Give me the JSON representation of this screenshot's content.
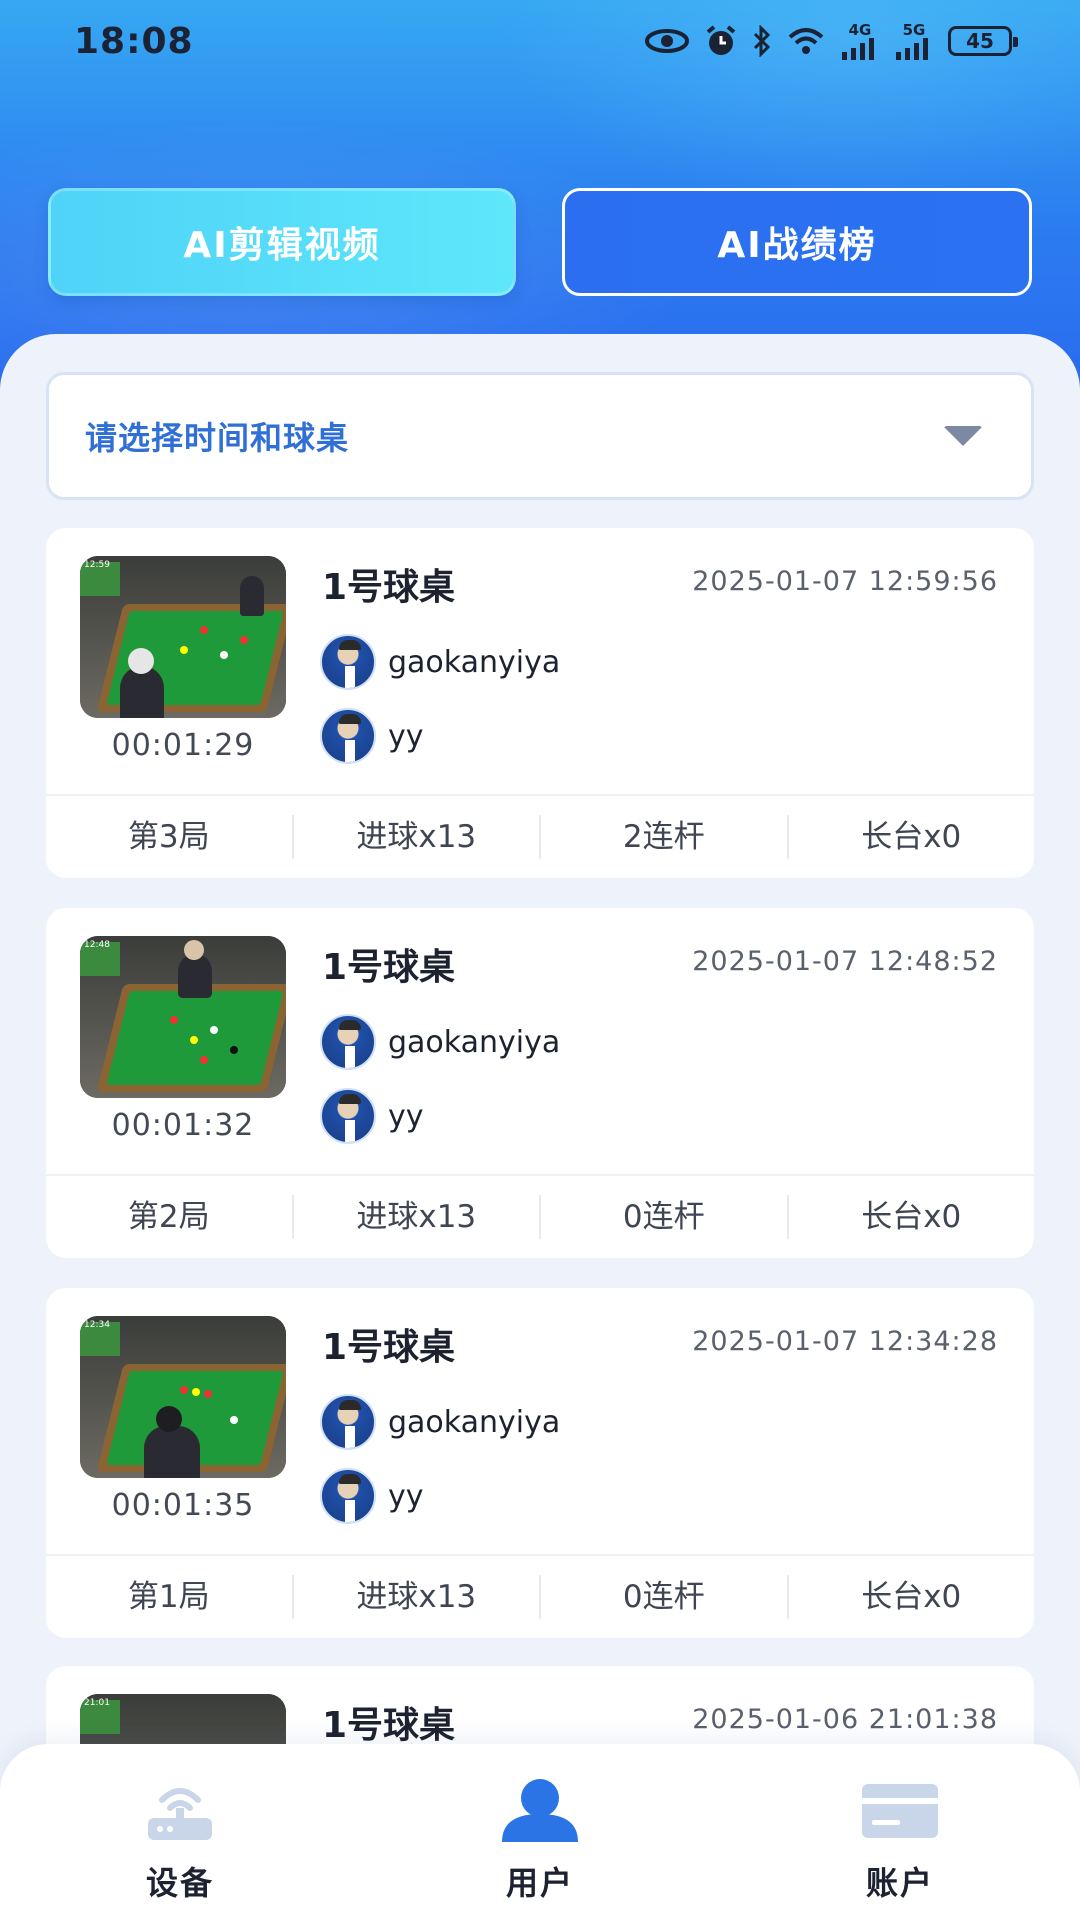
{
  "status_bar": {
    "time": "18:08",
    "battery": "45",
    "net1": "4G",
    "net2": "5G",
    "wifi_sup": "6"
  },
  "tabs": {
    "clip": "AI剪辑视频",
    "rank": "AI战绩榜"
  },
  "filter": {
    "placeholder": "请选择时间和球桌"
  },
  "records": [
    {
      "table": "1号球桌",
      "time": "2025-01-07 12:59:56",
      "duration": "00:01:29",
      "players": [
        "gaokanyiya",
        "yy"
      ],
      "stats": [
        "第3局",
        "进球x13",
        "2连杆",
        "长台x0"
      ]
    },
    {
      "table": "1号球桌",
      "time": "2025-01-07 12:48:52",
      "duration": "00:01:32",
      "players": [
        "gaokanyiya",
        "yy"
      ],
      "stats": [
        "第2局",
        "进球x13",
        "0连杆",
        "长台x0"
      ]
    },
    {
      "table": "1号球桌",
      "time": "2025-01-07 12:34:28",
      "duration": "00:01:35",
      "players": [
        "gaokanyiya",
        "yy"
      ],
      "stats": [
        "第1局",
        "进球x13",
        "0连杆",
        "长台x0"
      ]
    },
    {
      "table": "1号球桌",
      "time": "2025-01-06 21:01:38"
    }
  ],
  "nav": {
    "device": "设备",
    "user": "用户",
    "account": "账户",
    "active": "user",
    "active_color": "#2b74e6",
    "inactive_color": "#c9d6ea"
  }
}
